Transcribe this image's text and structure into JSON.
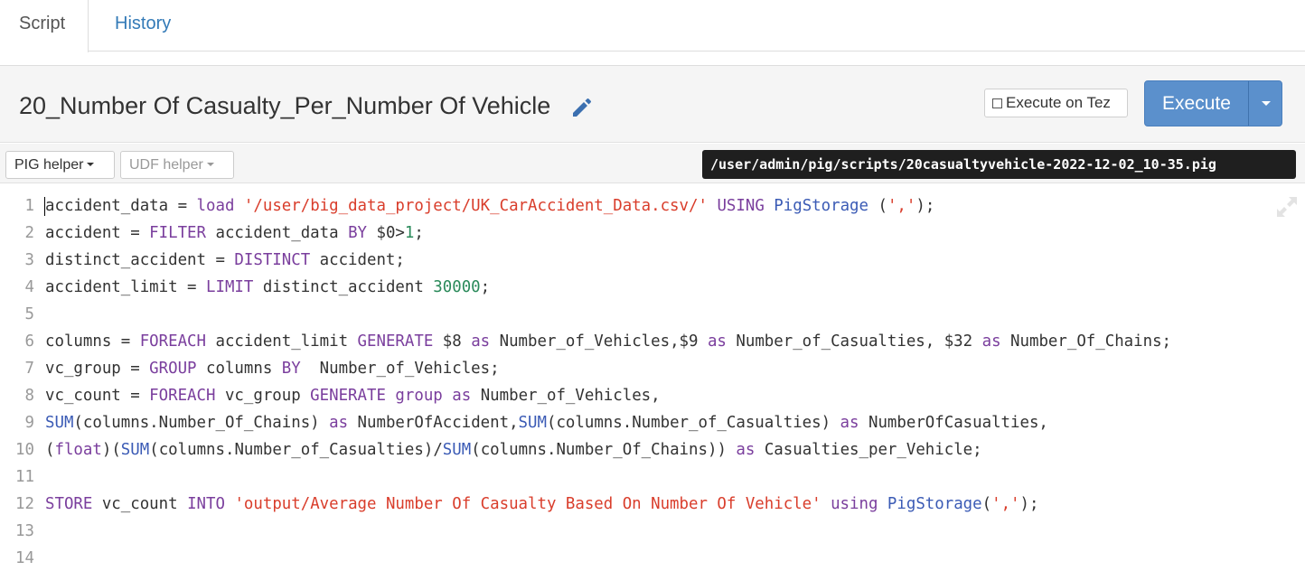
{
  "tabs": [
    {
      "label": "Script",
      "active": true
    },
    {
      "label": "History",
      "active": false
    }
  ],
  "header": {
    "title": "20_Number Of Casualty_Per_Number Of Vehicle",
    "edit_icon": "pencil-icon",
    "execute_on_tez_label": "Execute on Tez",
    "execute_on_tez_checked": false,
    "execute_label": "Execute"
  },
  "helpers": {
    "pig_label": "PIG helper",
    "udf_label": "UDF helper",
    "script_path": "/user/admin/pig/scripts/20casualtyvehicle-2022-12-02_10-35.pig"
  },
  "colors": {
    "execute_button": "#5b90cc",
    "link": "#337ab7",
    "keyword": "#7a3e9d",
    "string": "#d93d2b",
    "number": "#2a8a5a",
    "function": "#3b5bb5"
  },
  "editor": {
    "line_numbers": [
      "1",
      "2",
      "3",
      "4",
      "5",
      "6",
      "7",
      "8",
      "9",
      "10",
      "11",
      "12",
      "13",
      "14"
    ],
    "lines": [
      "accident_data = load '/user/big_data_project/UK_CarAccident_Data.csv/' USING PigStorage (',');",
      "accident = FILTER accident_data BY $0>1;",
      "distinct_accident = DISTINCT accident;",
      "accident_limit = LIMIT distinct_accident 30000;",
      "",
      "columns = FOREACH accident_limit GENERATE $8 as Number_of_Vehicles,$9 as Number_of_Casualties, $32 as Number_Of_Chains;",
      "vc_group = GROUP columns BY  Number_of_Vehicles;",
      "vc_count = FOREACH vc_group GENERATE group as Number_of_Vehicles,",
      "SUM(columns.Number_Of_Chains) as NumberOfAccident,SUM(columns.Number_of_Casualties) as NumberOfCasualties,",
      "(float)(SUM(columns.Number_of_Casualties)/SUM(columns.Number_Of_Chains)) as Casualties_per_Vehicle;",
      "",
      "STORE vc_count INTO 'output/Average Number Of Casualty Based On Number Of Vehicle' using PigStorage(',');",
      "",
      ""
    ],
    "expand_icon": "expand-icon"
  }
}
